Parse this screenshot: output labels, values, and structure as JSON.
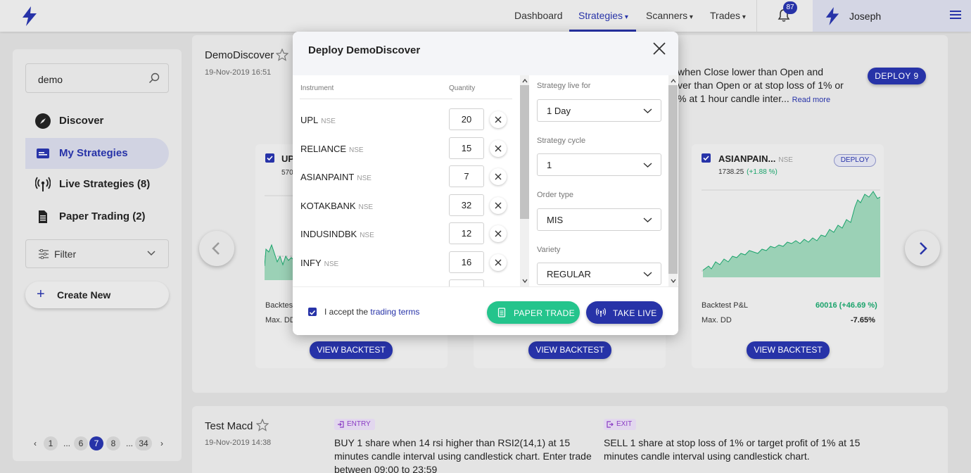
{
  "nav": {
    "items": [
      "Dashboard",
      "Strategies",
      "Scanners",
      "Trades"
    ],
    "active": "Strategies",
    "notification_count": "87",
    "user_name": "Joseph",
    "accent": "#2733a8"
  },
  "sidebar": {
    "search_value": "demo",
    "items": [
      {
        "label": "Discover",
        "icon": "compass-icon"
      },
      {
        "label": "My Strategies",
        "icon": "strategies-icon",
        "active": true
      },
      {
        "label": "Live Strategies (8)",
        "icon": "broadcast-icon"
      },
      {
        "label": "Paper Trading (2)",
        "icon": "document-icon"
      }
    ],
    "filter_label": "Filter",
    "create_label": "Create New",
    "pagination": [
      "1",
      "...",
      "6",
      "7",
      "8",
      "...",
      "34"
    ],
    "current_page": "7"
  },
  "strategy1": {
    "title": "DemoDiscover",
    "date": "19-Nov-2019 16:51",
    "desc_lines": [
      "when Close lower than Open and",
      "ver than Open or at stop loss of 1% or",
      "% at 1 hour candle inter..."
    ],
    "read_more": "Read more",
    "deploy_label": "DEPLOY 9",
    "cards": [
      {
        "name": "UP",
        "price": "570",
        "bt_label": "Backtes",
        "dd_label": "Max. DD",
        "button": "VIEW BACKTEST"
      },
      {
        "button": "VIEW BACKTEST"
      },
      {
        "name": "ASIANPAIN...",
        "exchange": "NSE",
        "price": "1738.25",
        "change": "(+1.88 %)",
        "deploy": "DEPLOY",
        "bt_label": "Backtest P&L",
        "bt_value": "60016 (+46.69 %)",
        "dd_label": "Max. DD",
        "dd_value": "-7.65%",
        "button": "VIEW BACKTEST"
      }
    ]
  },
  "strategy2": {
    "title": "Test Macd",
    "date": "19-Nov-2019 14:38",
    "entry_tag": "ENTRY",
    "exit_tag": "EXIT",
    "entry_lines": [
      "BUY 1 share when 14 rsi higher than RSI2(14,1) at 15",
      "minutes candle interval using candlestick chart. Enter trade",
      "between 09:00 to 23:59"
    ],
    "exit_lines": [
      "SELL 1 share at stop loss of 1% or target profit of 1% at 15",
      "minutes candle interval using candlestick chart."
    ]
  },
  "modal": {
    "title": "Deploy DemoDiscover",
    "col_instrument": "Instrument",
    "col_quantity": "Quantity",
    "rows": [
      {
        "name": "UPL",
        "exchange": "NSE",
        "qty": "20"
      },
      {
        "name": "RELIANCE",
        "exchange": "NSE",
        "qty": "15"
      },
      {
        "name": "ASIANPAINT",
        "exchange": "NSE",
        "qty": "7"
      },
      {
        "name": "KOTAKBANK",
        "exchange": "NSE",
        "qty": "32"
      },
      {
        "name": "INDUSINDBK",
        "exchange": "NSE",
        "qty": "12"
      },
      {
        "name": "INFY",
        "exchange": "NSE",
        "qty": "16"
      }
    ],
    "fields": [
      {
        "label": "Strategy live for",
        "value": "1 Day"
      },
      {
        "label": "Strategy cycle",
        "value": "1"
      },
      {
        "label": "Order type",
        "value": "MIS"
      },
      {
        "label": "Variety",
        "value": "REGULAR"
      }
    ],
    "accept_text": "I accept the",
    "accept_link": "trading terms",
    "paper_trade_label": "PAPER TRADE",
    "take_live_label": "TAKE LIVE",
    "green": "#24c48c"
  }
}
